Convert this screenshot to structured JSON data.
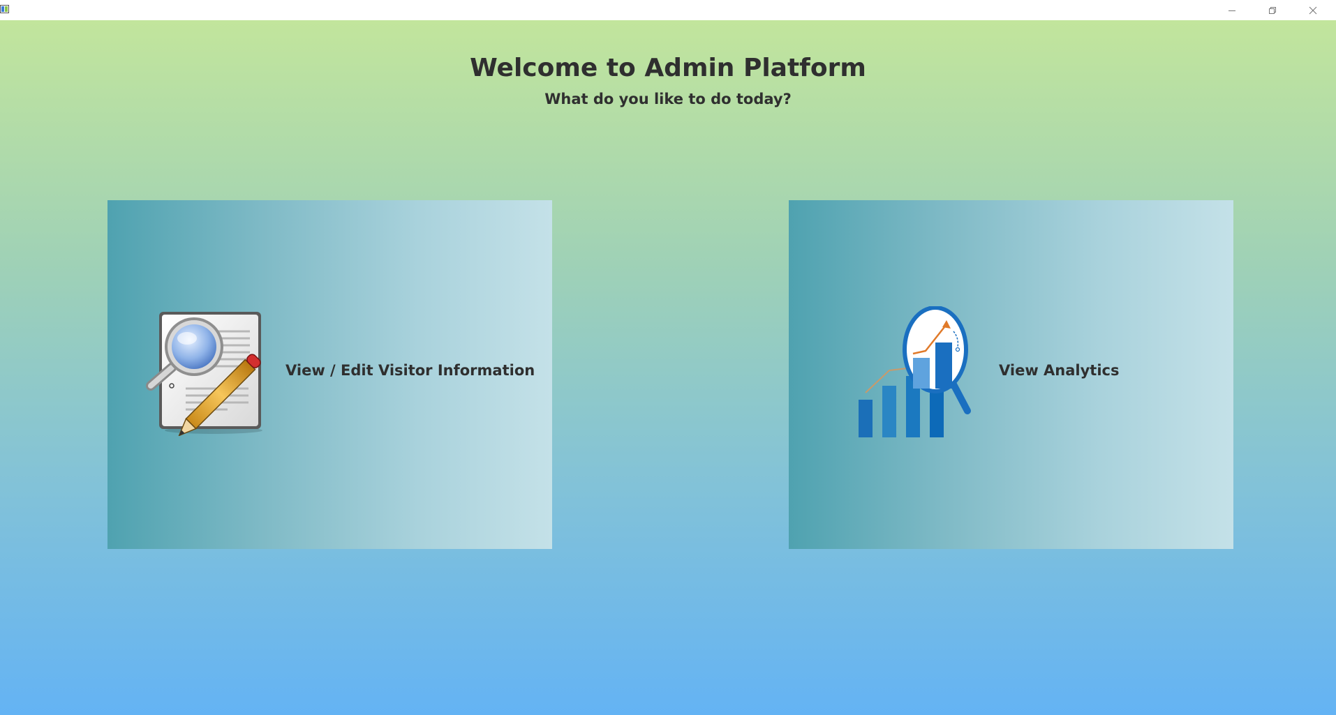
{
  "window": {
    "minimize_icon": "minimize-icon",
    "maximize_icon": "restore-icon",
    "close_icon": "close-icon"
  },
  "header": {
    "title": "Welcome to Admin Platform",
    "subtitle": "What do you like to do today?"
  },
  "cards": [
    {
      "label": "View / Edit Visitor Information",
      "icon": "document-edit-icon"
    },
    {
      "label": "View Analytics",
      "icon": "analytics-chart-icon"
    }
  ],
  "colors": {
    "background_top": "#c2e59c",
    "background_bottom": "#64b3f4",
    "card_left": "#4fa2b0",
    "card_right": "#c4e1e8",
    "text": "#2f2f2f"
  }
}
